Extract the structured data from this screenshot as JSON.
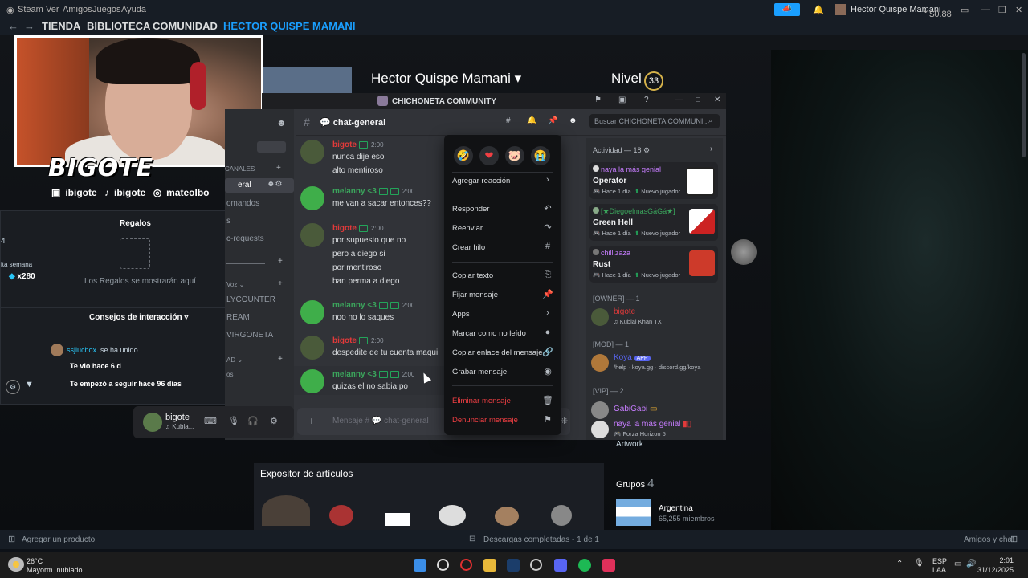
{
  "steam_menubar": {
    "app": "Steam",
    "items": [
      "Ver",
      "Amigos",
      "Juegos",
      "Ayuda"
    ],
    "user": "Hector Quispe Mamani",
    "balance": "$0.88"
  },
  "steam_nav": {
    "links": [
      "TIENDA",
      "BIBLIOTECA",
      "COMUNIDAD",
      "HECTOR QUISPE MAMANI"
    ]
  },
  "profile": {
    "name": "Hector Quispe Mamani",
    "level_label": "Nivel",
    "level": "33",
    "showcase_title": "Expositor de artículos",
    "artwork_label": "Artwork",
    "groups_label": "Grupos",
    "groups_count": "4",
    "group_name": "Argentina",
    "group_members": "65,255 miembros"
  },
  "overlay": {
    "logo": "BIGOTE",
    "socials": [
      "ibigote",
      "ibigote",
      "mateolbo"
    ]
  },
  "gifts_panel": {
    "title": "Regalos",
    "empty_text": "Los Regalos se mostrarán aquí",
    "week_label": "ita semana",
    "points": "x280",
    "num": "4",
    "tips_title": "Consejos de interacción",
    "follower_name": "ssjluchox",
    "follower_action": "se ha unido",
    "seen": "Te vio hace 6 d",
    "followed": "Te empezó a seguir hace 96 días"
  },
  "discord": {
    "window_title": "CHICHONETA COMMUNITY",
    "channel": "chat-general",
    "search_placeholder": "Buscar CHICHONETA COMMUNI...",
    "input_placeholder": "Mensaje # 💬 chat-general",
    "sidebar_items": [
      "CANALES",
      "eral",
      "omandos",
      "s",
      "c-requests",
      "Voz",
      "LYCOUNTER",
      "REAM",
      "VIRGONETA",
      "AD",
      "os"
    ],
    "user": {
      "name": "bigote",
      "status": "Kubla..."
    },
    "messages": [
      {
        "user": "bigote",
        "time": "2:00",
        "lines": [
          "nunca dije eso",
          "alto mentiroso"
        ],
        "color": "#e23a3a"
      },
      {
        "user": "melanny <3",
        "time": "2:00",
        "lines": [
          "me van a sacar entonces??"
        ],
        "color": "#3ba55c"
      },
      {
        "user": "bigote",
        "time": "2:00",
        "lines": [
          "por supuesto que no",
          "pero a diego si",
          "por mentiroso",
          "ban perma a diego"
        ],
        "color": "#e23a3a"
      },
      {
        "user": "melanny <3",
        "time": "2:00",
        "lines": [
          "noo no lo saques"
        ],
        "color": "#3ba55c"
      },
      {
        "user": "bigote",
        "time": "2:00",
        "lines": [
          "despedite de tu cuenta maqui"
        ],
        "color": "#e23a3a"
      },
      {
        "user": "melanny <3",
        "time": "2:00",
        "lines": [
          "quizas el no sabia po"
        ],
        "color": "#3ba55c"
      }
    ],
    "context_menu": {
      "reactions": [
        "🤣",
        "❤",
        "🐷",
        "😭"
      ],
      "items": [
        {
          "label": "Agregar reacción",
          "icon": "›"
        },
        {
          "label": "Responder",
          "icon": "↶"
        },
        {
          "label": "Reenviar",
          "icon": "↷"
        },
        {
          "label": "Crear hilo",
          "icon": "#"
        },
        {
          "label": "Copiar texto",
          "icon": "⎘"
        },
        {
          "label": "Fijar mensaje",
          "icon": "📌"
        },
        {
          "label": "Apps",
          "icon": "›"
        },
        {
          "label": "Marcar como no leído",
          "icon": "●"
        },
        {
          "label": "Copiar enlace del mensaje",
          "icon": "🔗"
        },
        {
          "label": "Grabar mensaje",
          "icon": "◉"
        },
        {
          "label": "Eliminar mensaje",
          "icon": "🗑"
        },
        {
          "label": "Denunciar mensaje",
          "icon": "⚑"
        }
      ]
    },
    "activity": {
      "header": "Actividad — 18",
      "cards": [
        {
          "name": "naya la más genial",
          "game": "Operator",
          "time": "Hace 1 día",
          "tag": "Nuevo jugador",
          "name_color": "#c77dff"
        },
        {
          "name": "[★DiegoelmasGáGá★]",
          "game": "Green Hell",
          "time": "Hace 1 día",
          "tag": "Nuevo jugador",
          "name_color": "#3ba55c"
        },
        {
          "name": "chill.zaza",
          "game": "Rust",
          "time": "Hace 1 día",
          "tag": "Nuevo jugador",
          "name_color": "#c77dff"
        }
      ]
    },
    "members": {
      "owner_header": "[OWNER] — 1",
      "owner": {
        "name": "bigote",
        "status": "Kublai Khan TX"
      },
      "mod_header": "[MOD] — 1",
      "mod": {
        "name": "Koya",
        "badge": "APP",
        "status": "/help · koya.gg · discord.gg/koya"
      },
      "vip_header": "[VIP] — 2",
      "vips": [
        {
          "name": "GabiGabi",
          "status": ""
        },
        {
          "name": "naya la más genial",
          "status": "Forza Horizon 5"
        }
      ]
    }
  },
  "steam_bottom": {
    "add_product": "Agregar un producto",
    "downloads": "Descargas completadas - 1 de 1",
    "friends": "Amigos y chat"
  },
  "taskbar": {
    "weather_temp": "26°C",
    "weather_desc": "Mayorm. nublado",
    "lang1": "ESP",
    "lang2": "LAA",
    "time": "2:01",
    "date": "31/12/2025"
  }
}
